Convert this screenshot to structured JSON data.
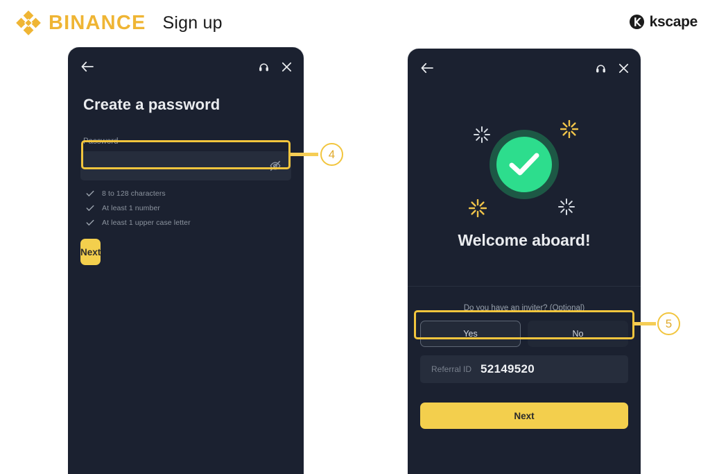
{
  "header": {
    "brand_name": "BINANCE",
    "page_title": "Sign up",
    "brand_color": "#efb534",
    "partner_logo_text": "kscape"
  },
  "left_phone": {
    "nav": {
      "back_icon": "arrow-left-icon",
      "support_icon": "headset-icon",
      "close_icon": "close-icon"
    },
    "title": "Create a password",
    "password_field": {
      "label": "Password",
      "value": "",
      "placeholder": "",
      "toggle_icon": "eye-off-icon"
    },
    "requirements": [
      "8 to 128 characters",
      "At least 1 number",
      "At least 1 upper case letter"
    ],
    "next_button": "Next"
  },
  "right_phone": {
    "nav": {
      "back_icon": "arrow-left-icon",
      "support_icon": "headset-icon",
      "close_icon": "close-icon"
    },
    "success": {
      "icon": "check-circle-icon",
      "heading": "Welcome aboard!",
      "accent_color": "#2ddd8d"
    },
    "inviter": {
      "question": "Do you have an inviter? (Optional)",
      "options": [
        "Yes",
        "No"
      ],
      "selected": "Yes"
    },
    "referral": {
      "label": "Referral ID",
      "value": "52149520"
    },
    "next_button": "Next"
  },
  "annotations": {
    "marker_color": "#f2c53d",
    "items": [
      {
        "number": "4",
        "target": "password-input"
      },
      {
        "number": "5",
        "target": "referral-id-field"
      }
    ]
  }
}
